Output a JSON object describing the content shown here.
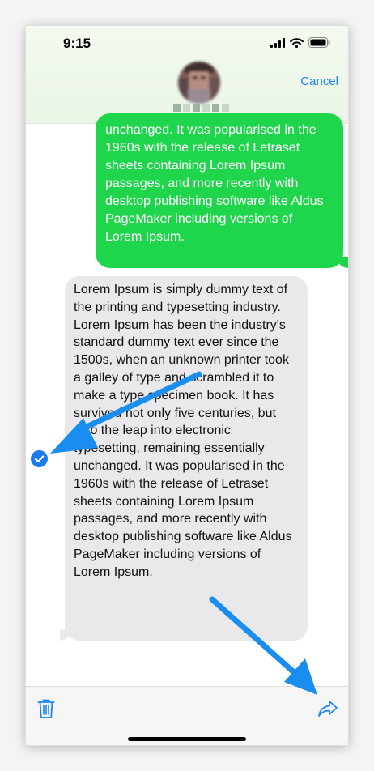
{
  "status_bar": {
    "time": "9:15"
  },
  "header": {
    "cancel_label": "Cancel"
  },
  "messages": {
    "sent_text": "unchanged. It was popularised in the 1960s with the release of Letraset sheets containing Lorem Ipsum passages, and more recently with desktop publishing software like Aldus PageMaker including versions of Lorem Ipsum.",
    "received_text": "Lorem Ipsum is simply dummy text of the printing and typesetting industry. Lorem Ipsum has been the industry's standard dummy text ever since the 1500s, when an unknown printer took a galley of type and scrambled it to make a type specimen book. It has survived not only five centuries, but also the leap into electronic typesetting, remaining essentially unchanged. It was popularised in the 1960s with the release of Letraset sheets containing Lorem Ipsum passages, and more recently with desktop publishing software like Aldus PageMaker including versions of Lorem Ipsum.",
    "received_selected": true
  },
  "toolbar": {
    "icons": [
      "trash-icon",
      "forward-share-icon"
    ]
  },
  "colors": {
    "sent_bubble": "#1ed54c",
    "received_bubble": "#e9e9eb",
    "accent_blue": "#1a86f5",
    "annotation_arrow": "#1a8ef0"
  }
}
